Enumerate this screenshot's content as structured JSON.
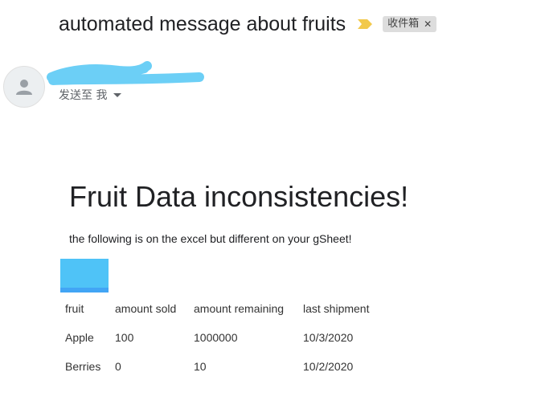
{
  "email": {
    "subject": "automated message about fruits",
    "label_chip": "收件箱",
    "label_remove_glyph": "✕",
    "recipient_text": "发送至 我",
    "important_marker_icon": "importance-marker-icon",
    "important_marker_color": "#f2c94c"
  },
  "sender": {
    "avatar_icon": "person-icon",
    "name_redaction_color": "#6ccff6"
  },
  "body": {
    "heading": "Fruit Data inconsistencies!",
    "intro": "the following is on the excel but different on your gSheet!",
    "image_color": "#4fc3f7",
    "table": {
      "headers": [
        "fruit",
        "amount sold",
        "amount remaining",
        "last shipment"
      ],
      "rows": [
        [
          "Apple",
          "100",
          "1000000",
          "10/3/2020"
        ],
        [
          "Berries",
          "0",
          "10",
          "10/2/2020"
        ]
      ]
    }
  }
}
